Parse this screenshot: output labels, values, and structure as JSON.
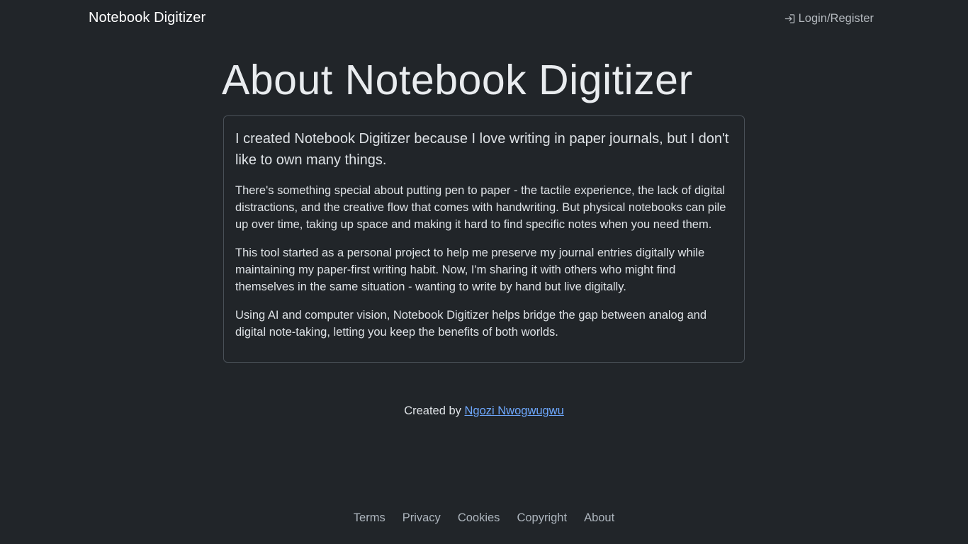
{
  "navbar": {
    "brand": "Notebook Digitizer",
    "login_icon": "login-arrow-icon",
    "login_label": "Login/Register"
  },
  "main": {
    "title": "About Notebook Digitizer",
    "lead": "I created Notebook Digitizer because I love writing in paper journals, but I don't like to own many things.",
    "paragraphs": [
      "There's something special about putting pen to paper - the tactile experience, the lack of digital distractions, and the creative flow that comes with handwriting. But physical notebooks can pile up over time, taking up space and making it hard to find specific notes when you need them.",
      "This tool started as a personal project to help me preserve my journal entries digitally while maintaining my paper-first writing habit. Now, I'm sharing it with others who might find themselves in the same situation - wanting to write by hand but live digitally.",
      "Using AI and computer vision, Notebook Digitizer helps bridge the gap between analog and digital note-taking, letting you keep the benefits of both worlds."
    ],
    "credit_prefix": "Created by ",
    "credit_name": "Ngozi Nwogwugwu"
  },
  "footer": {
    "links": [
      "Terms",
      "Privacy",
      "Cookies",
      "Copyright",
      "About"
    ]
  },
  "colors": {
    "background": "#212529",
    "text": "#dee2e6",
    "link": "#6ea8fe",
    "border": "#495057"
  }
}
